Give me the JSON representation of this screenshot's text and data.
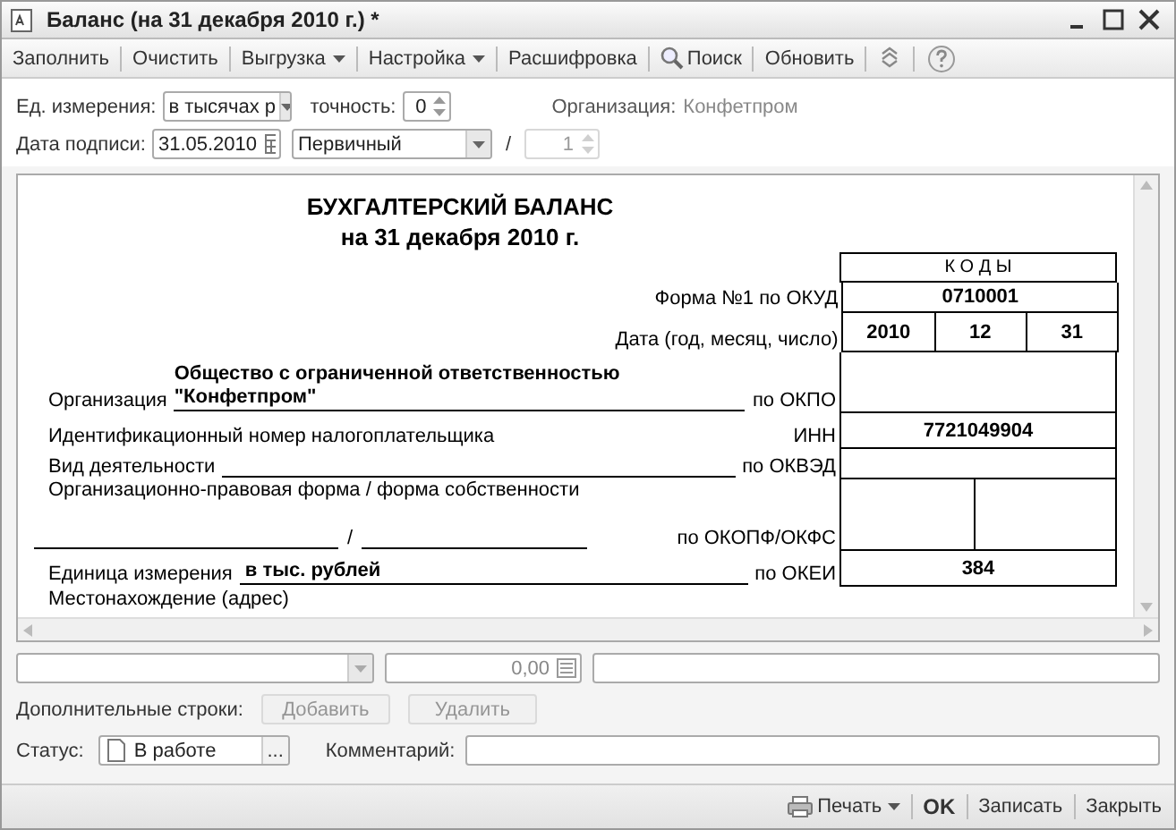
{
  "window": {
    "title": "Баланс (на 31 декабря 2010 г.) *"
  },
  "toolbar": [
    {
      "label": "Заполнить",
      "kind": "text",
      "dropdown": false
    },
    {
      "label": "Очистить",
      "kind": "text",
      "dropdown": false
    },
    {
      "label": "Выгрузка",
      "kind": "text",
      "dropdown": true
    },
    {
      "label": "Настройка",
      "kind": "text",
      "dropdown": true
    },
    {
      "label": "Расшифровка",
      "kind": "text",
      "dropdown": false
    },
    {
      "label": "Поиск",
      "kind": "search",
      "dropdown": false
    },
    {
      "label": "Обновить",
      "kind": "text",
      "dropdown": false
    }
  ],
  "params": {
    "unit_label": "Ед. измерения:",
    "unit_value": "в тысячах р",
    "precision_label": "точность:",
    "precision_value": "0",
    "organization_label": "Организация:",
    "organization_value": "Конфетпром",
    "date_label": "Дата подписи:",
    "date_value": "31.05.2010",
    "report_type": "Первичный",
    "separator": "/",
    "number": "1",
    "number_disabled": true
  },
  "report": {
    "title": "БУХГАЛТЕРСКИЙ БАЛАНС",
    "subtitle": "на 31 декабря 2010 г.",
    "codes_header": "К О Д Ы",
    "form_label": "Форма №1 по ОКУД",
    "form_code": "0710001",
    "date_label": "Дата (год, месяц, число)",
    "date_codes": [
      "2010",
      "12",
      "31"
    ],
    "org_label": "Организация",
    "org_name_lines": [
      "Общество с ограниченной ответственностью",
      "\"Конфетпром\""
    ],
    "okpo_label": "по ОКПО",
    "inn_caption": "Идентификационный номер налогоплательщика",
    "inn_label": "ИНН",
    "inn_code": "7721049904",
    "activity_label": "Вид деятельности",
    "okved_label": "по ОКВЭД",
    "legal_form_label": "Организационно-правовая форма / форма собственности",
    "legal_form_separator": "/",
    "okopf_label": "по ОКОПФ/ОКФС",
    "unit_label": "Единица измерения",
    "unit_value": "в тыс. рублей",
    "okei_label": "по ОКЕИ",
    "okei_code": "384",
    "address_label": "Местонахождение (адрес)"
  },
  "row_editor": {
    "amount": "0,00"
  },
  "extra_rows": {
    "label": "Дополнительные строки:",
    "buttons": [
      {
        "label": "Добавить",
        "disabled": true
      },
      {
        "label": "Удалить",
        "disabled": true
      }
    ]
  },
  "status": {
    "label": "Статус:",
    "value": "В работе",
    "select_button": "...",
    "comment_label": "Комментарий:"
  },
  "footer_buttons": [
    {
      "label": "Печать",
      "kind": "print"
    },
    {
      "label": "OK",
      "kind": "default"
    },
    {
      "label": "Записать",
      "kind": "plain"
    },
    {
      "label": "Закрыть",
      "kind": "plain"
    }
  ]
}
